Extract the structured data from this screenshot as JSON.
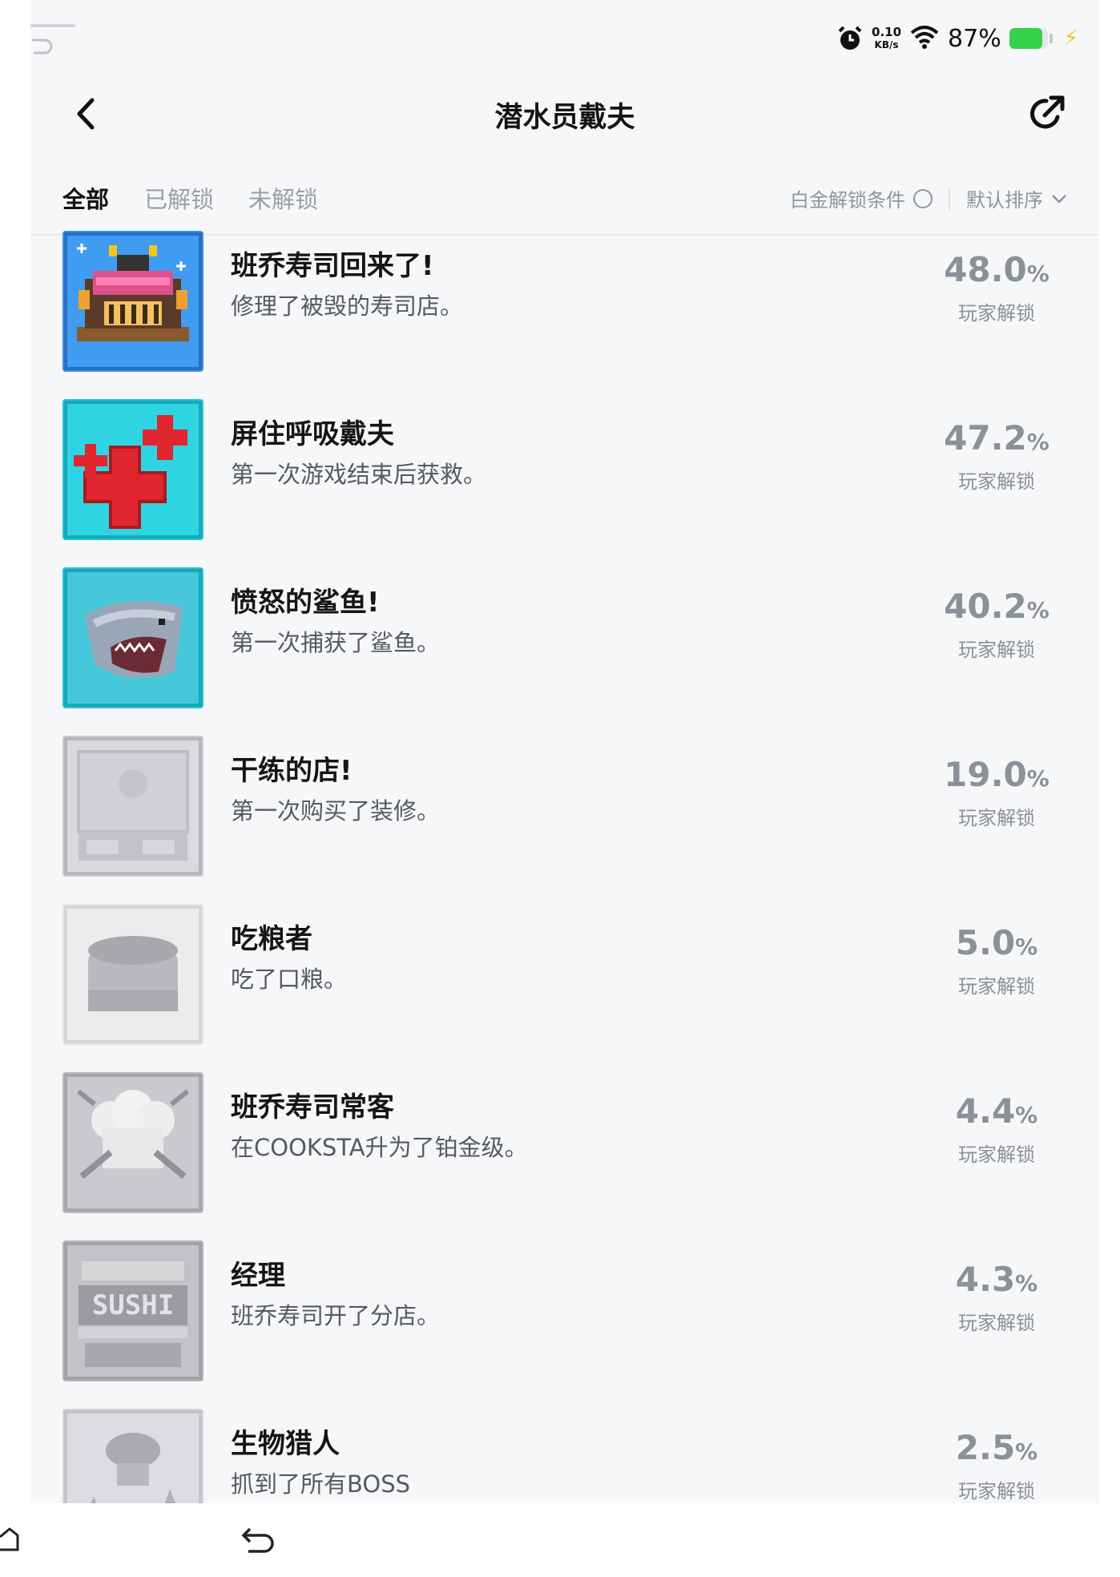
{
  "status_bar": {
    "net_speed_value": "0.10",
    "net_speed_unit": "KB/s",
    "battery_percent": "87%",
    "battery_level": 0.87,
    "icons": [
      "alarm-icon",
      "wifi-icon",
      "battery-icon",
      "charging-icon"
    ]
  },
  "header": {
    "title": "潜水员戴夫",
    "back_icon": "chevron-left-icon",
    "share_icon": "share-icon"
  },
  "filters": {
    "tabs": [
      {
        "label": "全部",
        "active": true
      },
      {
        "label": "已解锁",
        "active": false
      },
      {
        "label": "未解锁",
        "active": false
      }
    ],
    "platinum_label": "白金解锁条件",
    "sort_label": "默认排序"
  },
  "achievements": [
    {
      "name": "班乔寿司回来了!",
      "desc": "修理了被毁的寿司店。",
      "percent": "48.0",
      "unit": "%",
      "caption": "玩家解锁",
      "icon": "sushi-shop-badge",
      "unlocked": true
    },
    {
      "name": "屏住呼吸戴夫",
      "desc": "第一次游戏结束后获救。",
      "percent": "47.2",
      "unit": "%",
      "caption": "玩家解锁",
      "icon": "medical-cross-badge",
      "unlocked": true
    },
    {
      "name": "愤怒的鲨鱼!",
      "desc": "第一次捕获了鲨鱼。",
      "percent": "40.2",
      "unit": "%",
      "caption": "玩家解锁",
      "icon": "shark-badge",
      "unlocked": true
    },
    {
      "name": "干练的店!",
      "desc": "第一次购买了装修。",
      "percent": "19.0",
      "unit": "%",
      "caption": "玩家解锁",
      "icon": "shop-interior-badge",
      "unlocked": false
    },
    {
      "name": "吃粮者",
      "desc": "吃了口粮。",
      "percent": "5.0",
      "unit": "%",
      "caption": "玩家解锁",
      "icon": "ration-can-badge",
      "unlocked": false
    },
    {
      "name": "班乔寿司常客",
      "desc": "在COOKSTA升为了铂金级。",
      "percent": "4.4",
      "unit": "%",
      "caption": "玩家解锁",
      "icon": "chef-hat-badge",
      "unlocked": false
    },
    {
      "name": "经理",
      "desc": "班乔寿司开了分店。",
      "percent": "4.3",
      "unit": "%",
      "caption": "玩家解锁",
      "icon": "sushi-sign-badge",
      "unlocked": false,
      "badge_text": "SUSHI"
    },
    {
      "name": "生物猎人",
      "desc": "抓到了所有BOSS",
      "percent": "2.5",
      "unit": "%",
      "caption": "玩家解锁",
      "icon": "boss-hunter-badge",
      "unlocked": false
    }
  ],
  "bottom_nav": {
    "icons": [
      "home-icon",
      "back-icon"
    ]
  }
}
